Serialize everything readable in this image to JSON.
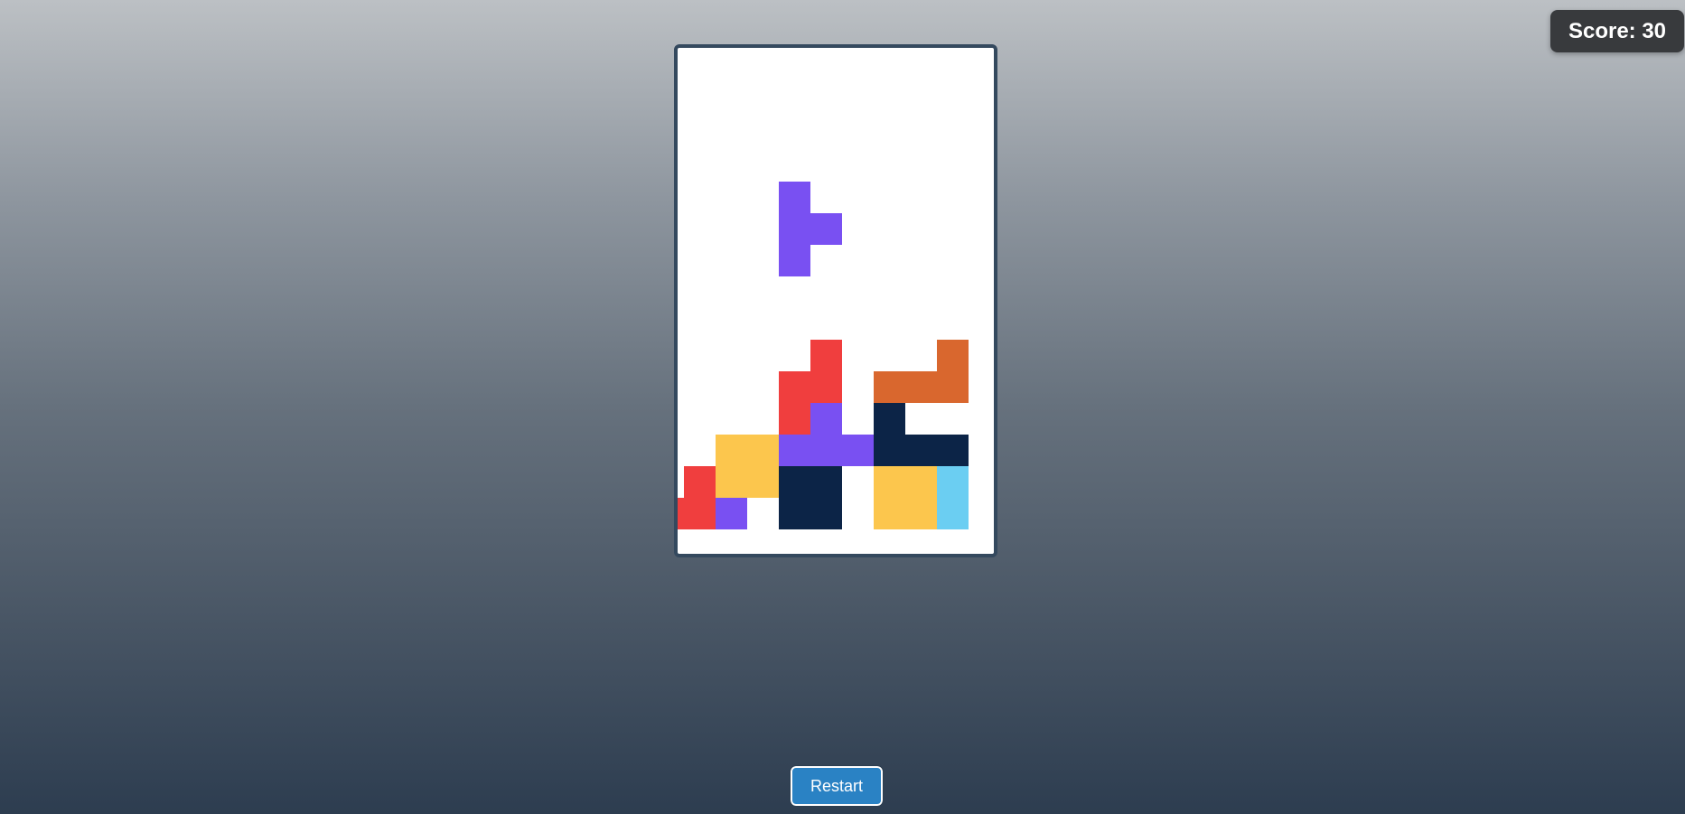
{
  "score": {
    "label": "Score:",
    "value": 30,
    "text": "Score: 30"
  },
  "restart_label": "Restart",
  "colors": {
    "background_top": "#bcc0c4",
    "background_bottom": "#2d3d50",
    "board_background": "#ffffff",
    "board_border": "#34495e",
    "score_background": "#383a3d",
    "restart_background": "#2a82c4",
    "R": "#f03e3e",
    "P": "#7950f2",
    "Y": "#fcc64d",
    "N": "#0c2447",
    "O": "#d9672e",
    "C": "#6bcef2"
  },
  "board": {
    "columns": 10,
    "rows": 16,
    "grid": [
      "..........",
      "..........",
      "..........",
      "..........",
      "..........",
      "..........",
      "..........",
      "..........",
      "..........",
      ".....R...O",
      "....RR.OOO",
      "....RP.N..",
      "..YYPPPNNN",
      ".RYYNN.YYC",
      "RRP.NN.YYC",
      ".........."
    ]
  },
  "active_piece": {
    "type": "T",
    "color_key": "P",
    "cells": [
      [
        4,
        4
      ],
      [
        4,
        5
      ],
      [
        5,
        5
      ],
      [
        4,
        6
      ]
    ]
  }
}
